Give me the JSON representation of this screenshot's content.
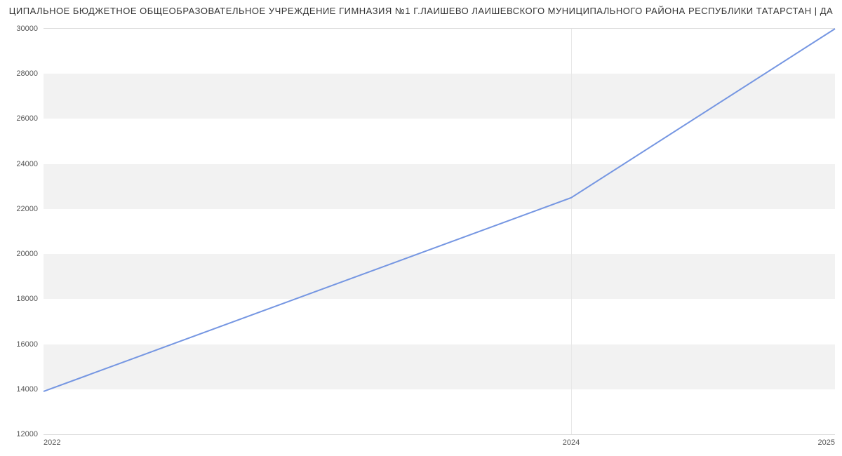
{
  "chart_data": {
    "type": "line",
    "title": "ЦИПАЛЬНОЕ БЮДЖЕТНОЕ ОБЩЕОБРАЗОВАТЕЛЬНОЕ УЧРЕЖДЕНИЕ ГИМНАЗИЯ №1 Г.ЛАИШЕВО ЛАИШЕВСКОГО МУНИЦИПАЛЬНОГО РАЙОНА РЕСПУБЛИКИ ТАТАРСТАН | ДА",
    "x": [
      2022,
      2024,
      2025
    ],
    "values": [
      13900,
      22500,
      30000
    ],
    "x_ticks": [
      2022,
      2024,
      2025
    ],
    "y_ticks": [
      12000,
      14000,
      16000,
      18000,
      20000,
      22000,
      24000,
      26000,
      28000,
      30000
    ],
    "xlim": [
      2022,
      2025
    ],
    "ylim": [
      12000,
      30000
    ],
    "xlabel": "",
    "ylabel": "",
    "line_color": "#7596e2",
    "band_color": "#f2f2f2"
  }
}
